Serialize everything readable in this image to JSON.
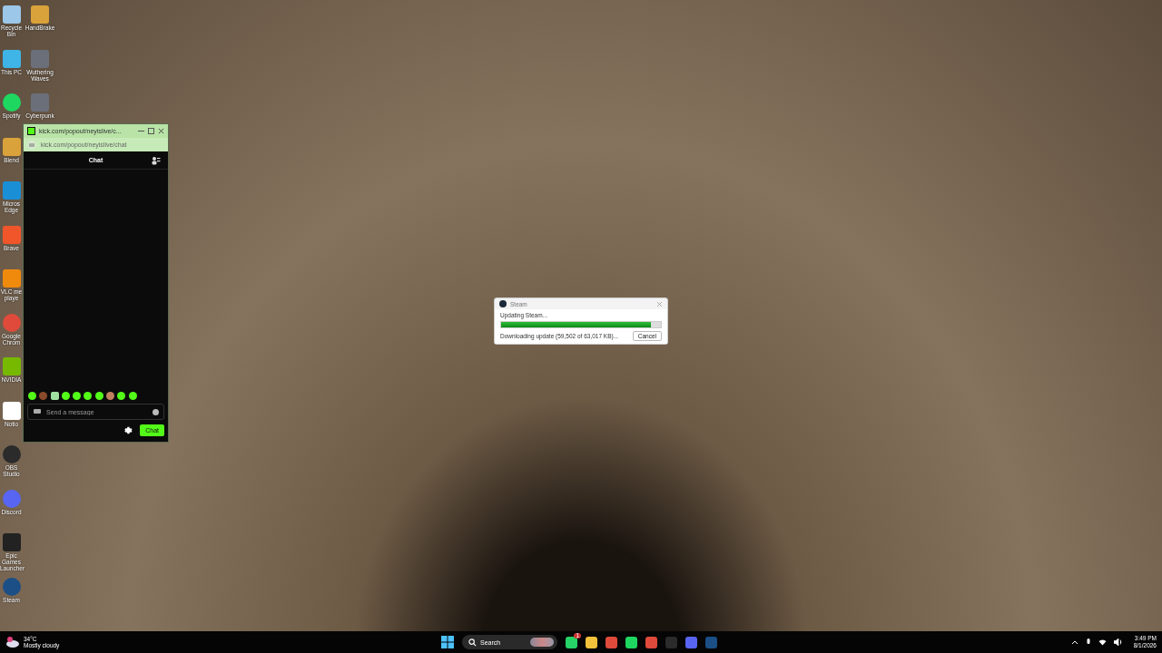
{
  "desktop_columns": [
    {
      "icons": [
        {
          "label": "Recycle Bin",
          "kind": "bin"
        },
        {
          "label": "This PC",
          "kind": "pc"
        },
        {
          "label": "Spotify",
          "kind": "spotify"
        },
        {
          "label": "Blend",
          "kind": "app"
        },
        {
          "label": "Micros Edge",
          "kind": "edge"
        },
        {
          "label": "Brave",
          "kind": "brave"
        },
        {
          "label": "VLC me playe",
          "kind": "vlc"
        },
        {
          "label": "Google Chrom",
          "kind": "chrome"
        },
        {
          "label": "NVIDIA",
          "kind": "nvidia"
        },
        {
          "label": "Notio",
          "kind": "notion"
        },
        {
          "label": "OBS Studio",
          "kind": "obs"
        },
        {
          "label": "Discord",
          "kind": "discord"
        },
        {
          "label": "Epic Games Launcher",
          "kind": "epic"
        },
        {
          "label": "Steam",
          "kind": "steam"
        }
      ]
    },
    {
      "icons": [
        {
          "label": "HandBrake",
          "kind": "app"
        },
        {
          "label": "Wuthering Waves",
          "kind": "game"
        },
        {
          "label": "Cyberpunk",
          "kind": "game"
        }
      ]
    }
  ],
  "chat_window": {
    "title": "kick.com/popout/neyislive/c...",
    "url": "kick.com/popout/neyislive/chat",
    "header": "Chat",
    "emotes": [
      {
        "kind": "frog"
      },
      {
        "kind": "bear"
      },
      {
        "kind": "robot"
      },
      {
        "kind": "frog"
      },
      {
        "kind": "frog"
      },
      {
        "kind": "frog"
      },
      {
        "kind": "frog"
      },
      {
        "kind": "monkey"
      },
      {
        "kind": "frog"
      },
      {
        "kind": "frog"
      }
    ],
    "placeholder": "Send a message",
    "send_button": "Chat"
  },
  "steam_dialog": {
    "title": "Steam",
    "status": "Updating Steam...",
    "level": 0.94,
    "detail": "Downloading update (59,502 of 63,017 KB)...",
    "cancel_button": "Cancel"
  },
  "taskbar": {
    "temperature": "34°C",
    "weather": "Mostly cloudy",
    "search_placeholder": "Search",
    "apps": [
      {
        "kind": "whatsapp",
        "badge": "1"
      },
      {
        "kind": "folder"
      },
      {
        "kind": "chrome"
      },
      {
        "kind": "spotify"
      },
      {
        "kind": "chrome"
      },
      {
        "kind": "obs"
      },
      {
        "kind": "discord"
      },
      {
        "kind": "steam"
      }
    ],
    "time": "3:49 PM",
    "date": "8/1/2026"
  }
}
